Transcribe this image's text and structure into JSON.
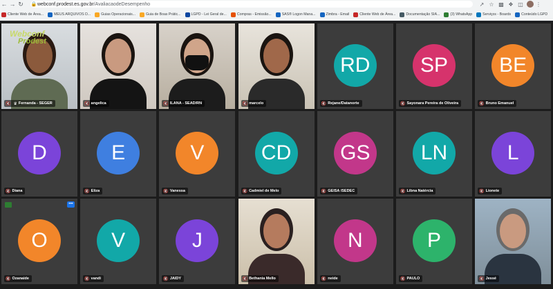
{
  "browser": {
    "url_host": "webconf.prodest.es.gov.br",
    "url_path": "/AvaliacaodeDesempenho",
    "bookmarks": [
      {
        "label": "Cliente Web de Área...",
        "color": "#c62828"
      },
      {
        "label": "MEUS ARQUIVOS D...",
        "color": "#1565c0"
      },
      {
        "label": "Guias Operacionais...",
        "color": "#f9a825"
      },
      {
        "label": "Guia de Boas Prátic...",
        "color": "#f9a825"
      },
      {
        "label": "LGPD - Lei Geral de...",
        "color": "#0d47a1"
      },
      {
        "label": "Compras - Emissão...",
        "color": "#e65100"
      },
      {
        "label": "SAS® Logon Mana...",
        "color": "#1565c0"
      },
      {
        "label": "Zimbra - Email",
        "color": "#1565c0"
      },
      {
        "label": "Cliente Web de Área...",
        "color": "#c62828"
      },
      {
        "label": "Documentação SIA...",
        "color": "#455a64"
      },
      {
        "label": "(3) WhatsApp",
        "color": "#2e7d32"
      },
      {
        "label": "Serviços - Boards",
        "color": "#0277bd"
      },
      {
        "label": "Conteúdo LGPD",
        "color": "#1565c0"
      }
    ]
  },
  "participants": [
    {
      "name": "Fernanda - SEGER",
      "type": "video",
      "logo1": "Webconf",
      "logo2": "Prodest"
    },
    {
      "name": "angelica",
      "type": "video",
      "speaking": true
    },
    {
      "name": "ILANA - SEAD/RN",
      "type": "video"
    },
    {
      "name": "marcelo",
      "type": "video"
    },
    {
      "name": "Rejane/Datanorte",
      "initials": "RD",
      "color": "#12a8a8"
    },
    {
      "name": "Sayonara Pereira de Oliveira",
      "initials": "SP",
      "color": "#d6336c"
    },
    {
      "name": "Bruno Emanuel",
      "initials": "BE",
      "color": "#f2862a"
    },
    {
      "name": "Diana",
      "initials": "D",
      "color": "#7b44d9"
    },
    {
      "name": "Eliza",
      "initials": "E",
      "color": "#3f7fe0"
    },
    {
      "name": "Vanessa",
      "initials": "V",
      "color": "#f2862a"
    },
    {
      "name": "Cadmiel de Melo",
      "initials": "CD",
      "color": "#12a8a8"
    },
    {
      "name": "GEISA /SEDEC",
      "initials": "GS",
      "color": "#c2378a"
    },
    {
      "name": "Libna Natércia",
      "initials": "LN",
      "color": "#12a8a8"
    },
    {
      "name": "Lionete",
      "initials": "L",
      "color": "#7b44d9"
    },
    {
      "name": "Ozanaide",
      "initials": "O",
      "color": "#f2862a"
    },
    {
      "name": "vandi",
      "initials": "V",
      "color": "#12a8a8"
    },
    {
      "name": "JAIDY",
      "initials": "J",
      "color": "#7b44d9"
    },
    {
      "name": "Bethania Mello",
      "type": "video"
    },
    {
      "name": "neide",
      "initials": "N",
      "color": "#c2378a"
    },
    {
      "name": "PAULO",
      "initials": "P",
      "color": "#2db36b"
    },
    {
      "name": "Jessé",
      "type": "video"
    }
  ]
}
